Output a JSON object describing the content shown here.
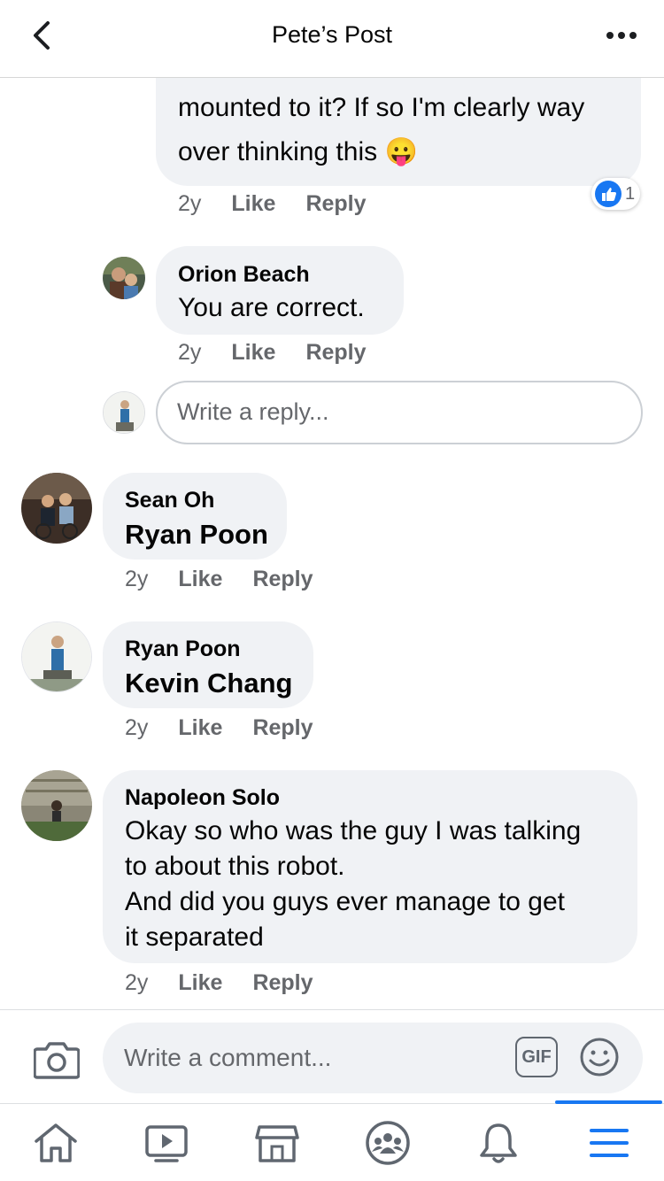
{
  "header": {
    "title": "Pete’s Post"
  },
  "comments": [
    {
      "text_line1": "mounted to it? If so I'm clearly way",
      "text_line2": "over thinking this",
      "emoji": "😛",
      "time": "2y",
      "like": "Like",
      "reply": "Reply",
      "reactions": "1"
    },
    {
      "author": "Orion Beach",
      "text": "You are correct.",
      "time": "2y",
      "like": "Like",
      "reply": "Reply"
    },
    {
      "author": "Sean Oh",
      "mention": "Ryan Poon",
      "time": "2y",
      "like": "Like",
      "reply": "Reply"
    },
    {
      "author": "Ryan Poon",
      "mention": "Kevin Chang",
      "time": "2y",
      "like": "Like",
      "reply": "Reply"
    },
    {
      "author": "Napoleon Solo",
      "lines": [
        "Okay so who was the guy I was talking",
        "to about this robot.",
        "And did you guys ever manage to get",
        "it separated"
      ],
      "time": "2y",
      "like": "Like",
      "reply": "Reply"
    }
  ],
  "reply_box": {
    "placeholder": "Write a reply..."
  },
  "composer": {
    "placeholder": "Write a comment...",
    "gif": "GIF"
  },
  "nav": [
    "home-icon",
    "watch-icon",
    "marketplace-icon",
    "groups-icon",
    "notifications-icon",
    "menu-icon"
  ],
  "colors": {
    "accent": "#1877f2",
    "bubble": "#f0f2f5",
    "meta": "#65676b"
  }
}
